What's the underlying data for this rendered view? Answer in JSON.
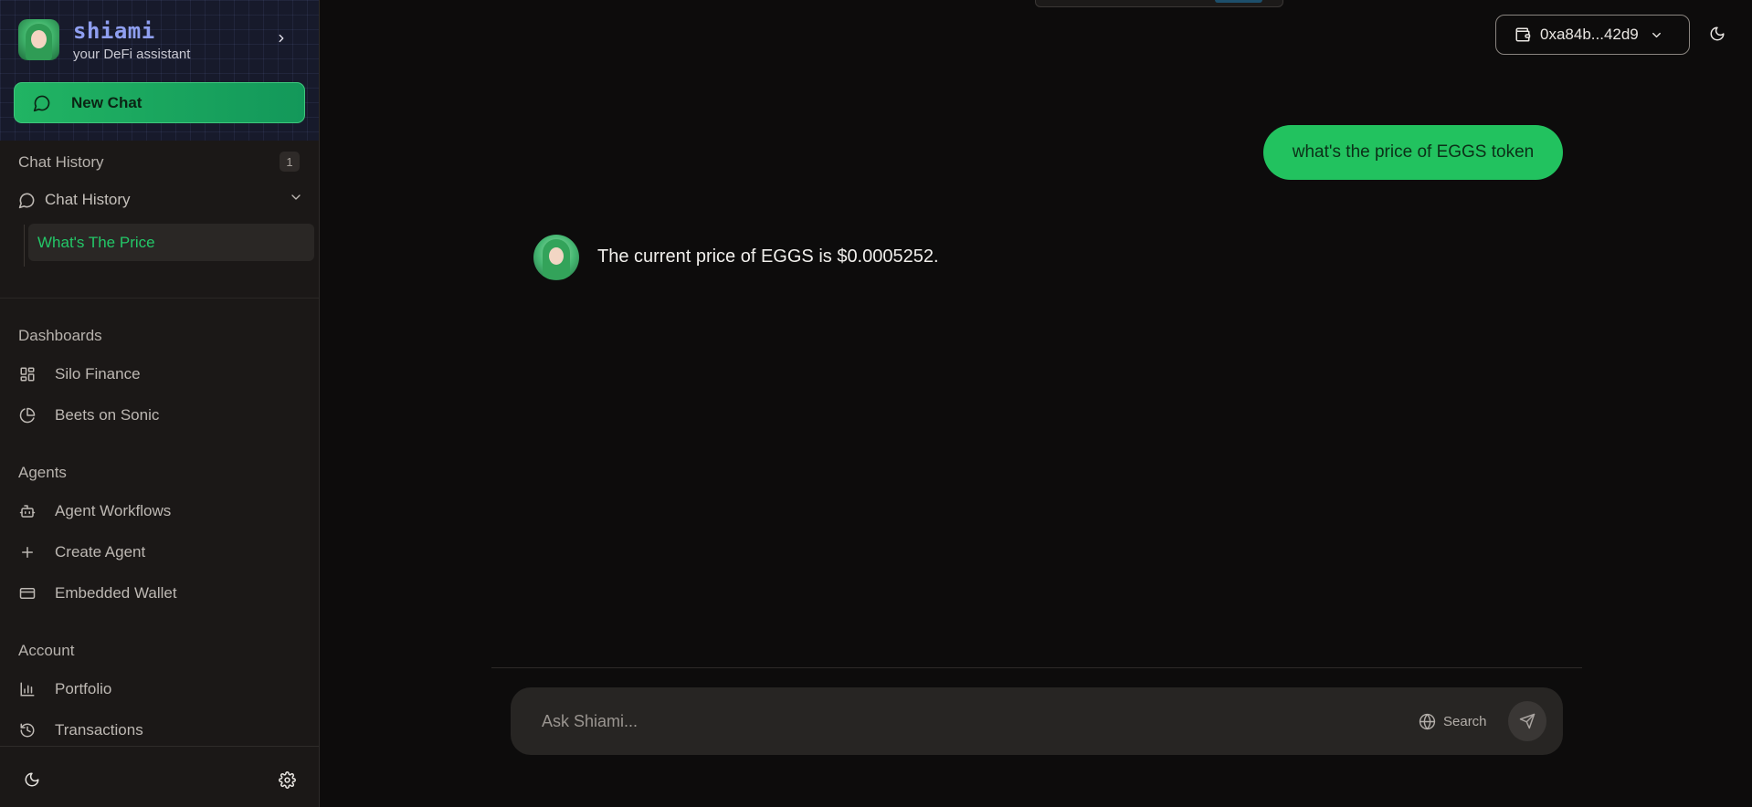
{
  "brand": {
    "name": "shiami",
    "tagline": "your DeFi assistant"
  },
  "sidebar": {
    "new_chat_label": "New Chat",
    "chat_history": {
      "section_title": "Chat History",
      "count": "1",
      "group_label": "Chat History",
      "items": [
        {
          "label": "What's The Price",
          "active": true
        }
      ]
    },
    "dashboards": {
      "section_title": "Dashboards",
      "items": [
        {
          "label": "Silo Finance",
          "icon": "dashboard-grid-icon"
        },
        {
          "label": "Beets on Sonic",
          "icon": "pie-chart-icon"
        }
      ]
    },
    "agents": {
      "section_title": "Agents",
      "items": [
        {
          "label": "Agent Workflows",
          "icon": "bot-icon"
        },
        {
          "label": "Create Agent",
          "icon": "plus-icon"
        },
        {
          "label": "Embedded Wallet",
          "icon": "credit-card-icon"
        }
      ]
    },
    "account": {
      "section_title": "Account",
      "items": [
        {
          "label": "Portfolio",
          "icon": "bar-chart-icon"
        },
        {
          "label": "Transactions",
          "icon": "history-icon"
        }
      ]
    }
  },
  "header": {
    "wallet_address": "0xa84b...42d9"
  },
  "chat": {
    "messages": [
      {
        "role": "user",
        "text": "what's the price of EGGS token"
      },
      {
        "role": "assistant",
        "text": "The current price of EGGS is $0.0005252."
      }
    ]
  },
  "composer": {
    "placeholder": "Ask Shiami...",
    "search_label": "Search"
  },
  "colors": {
    "accent": "#22c25f",
    "brand_name": "#8f9ff0",
    "background": "#0d0c0c",
    "sidebar": "#1b1817"
  }
}
